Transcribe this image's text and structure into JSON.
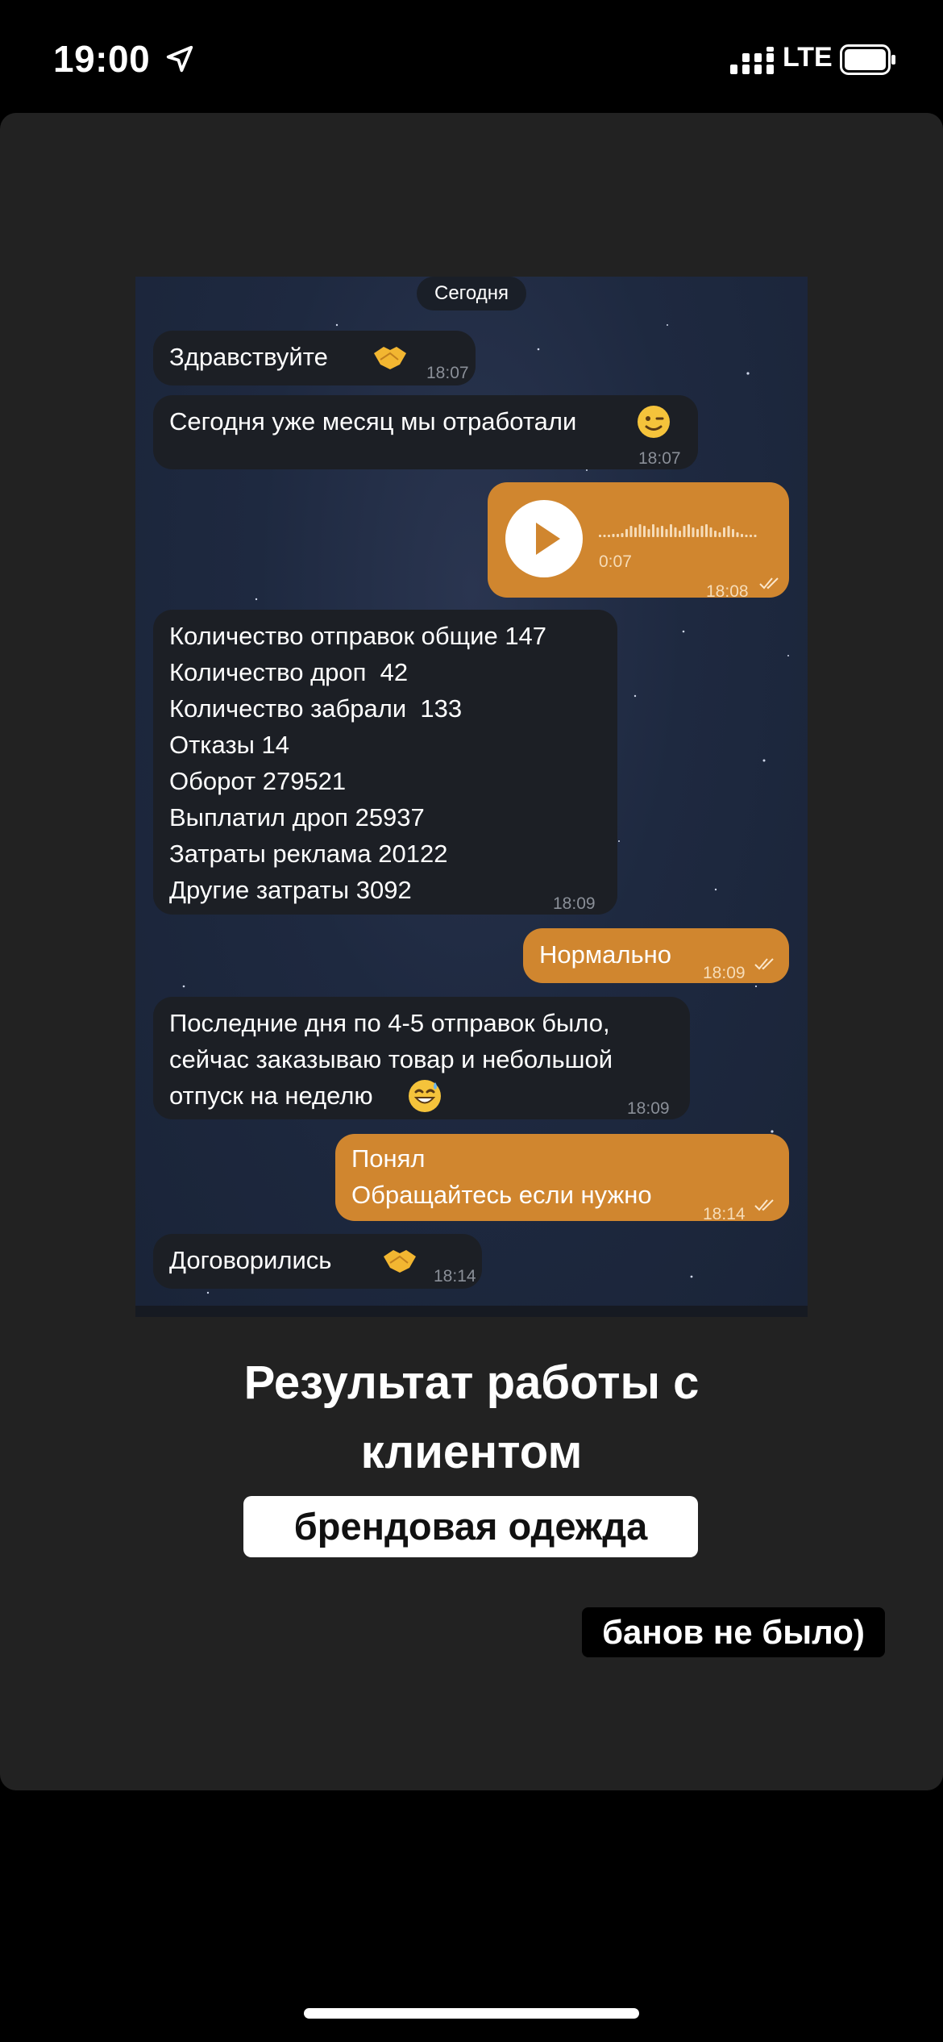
{
  "status_bar": {
    "time": "19:00",
    "network": "LTE"
  },
  "chat": {
    "date_label": "Сегодня",
    "messages": [
      {
        "dir": "in",
        "text": "Здравствуйте",
        "emoji": "handshake",
        "time": "18:07"
      },
      {
        "dir": "in",
        "text": "Сегодня уже месяц мы отработали",
        "emoji": "wink",
        "time": "18:07"
      },
      {
        "dir": "out",
        "type": "voice",
        "duration": "0:07",
        "time": "18:08",
        "read": true
      },
      {
        "dir": "in",
        "lines": [
          "Количество отправок общие 147",
          "Количество дроп  42",
          "Количество забрали  133",
          "Отказы 14",
          "Оборот 279521",
          "Выплатил дроп 25937",
          "Затраты реклама 20122",
          "Другие затраты 3092"
        ],
        "time": "18:09"
      },
      {
        "dir": "out",
        "text": "Нормально",
        "time": "18:09",
        "read": true
      },
      {
        "dir": "in",
        "lines": [
          "Последние дня по 4-5 отправок было,",
          "сейчас заказываю товар и небольшой",
          "отпуск на неделю"
        ],
        "emoji": "sweat-smile",
        "time": "18:09"
      },
      {
        "dir": "out",
        "lines": [
          "Понял",
          "Обращайтесь если нужно"
        ],
        "time": "18:14",
        "read": true
      },
      {
        "dir": "in",
        "text": "Договорились",
        "emoji": "handshake",
        "time": "18:14"
      }
    ]
  },
  "caption": {
    "title_line1": "Результат работы с",
    "title_line2": "клиентом",
    "tag": "брендовая одежда",
    "note": "банов не было)"
  },
  "colors": {
    "background": "#000000",
    "card": "#222222",
    "incoming_bubble": "#1c1f25",
    "outgoing_bubble": "#d0862f"
  },
  "icons": [
    "location-arrow-icon",
    "signal-bars-icon",
    "battery-icon",
    "play-icon",
    "waveform-icon",
    "double-check-icon",
    "handshake-emoji",
    "wink-emoji",
    "sweat-smile-emoji"
  ]
}
